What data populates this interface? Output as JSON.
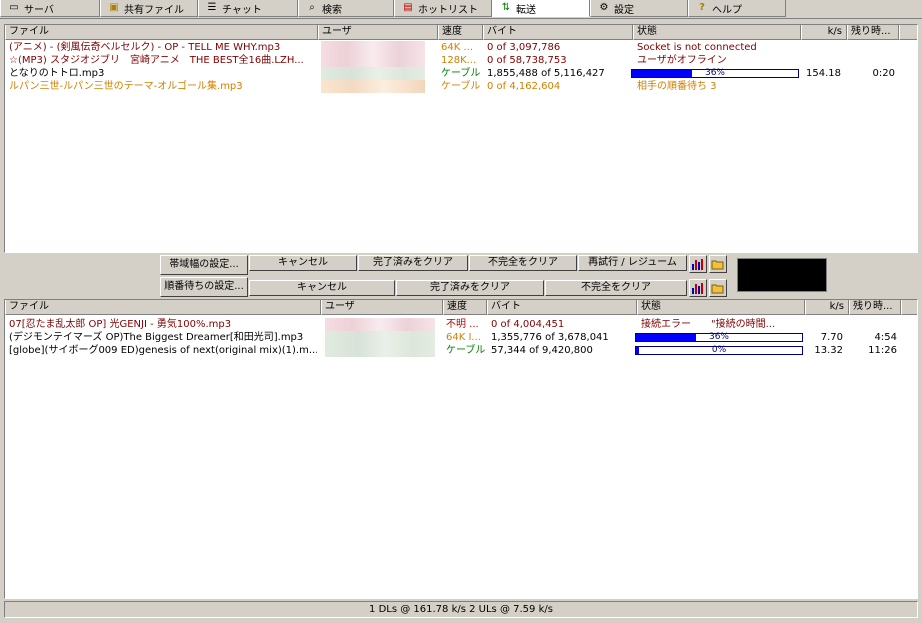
{
  "tabs": [
    {
      "label": "サーバ",
      "icon": "server-icon",
      "glyph": "▭"
    },
    {
      "label": "共有ファイル",
      "icon": "folder-icon",
      "glyph": "▣"
    },
    {
      "label": "チャット",
      "icon": "chat-icon",
      "glyph": "☰"
    },
    {
      "label": "検索",
      "icon": "search-icon",
      "glyph": "⌕"
    },
    {
      "label": "ホットリスト",
      "icon": "hotlist-icon",
      "glyph": "▤"
    },
    {
      "label": "転送",
      "icon": "transfer-arrows-icon",
      "glyph": "⇅"
    },
    {
      "label": "設定",
      "icon": "settings-icon",
      "glyph": "⚙"
    },
    {
      "label": "ヘルプ",
      "icon": "help-icon",
      "glyph": "?"
    }
  ],
  "downloads": {
    "columns": {
      "file": "ファイル",
      "user": "ユーザ",
      "speed": "速度",
      "bytes": "バイト",
      "status": "状態",
      "rate": "k/s",
      "remaining": "残り時..."
    },
    "rows": [
      {
        "file": "(アニメ) - (剣風伝奇ベルセルク) - OP - TELL ME WHY.mp3",
        "speed": "64K ...",
        "bytes": "0 of 3,097,786",
        "status": "Socket is not connected",
        "rate": "",
        "remaining": "",
        "color": "#800000",
        "speed_color": "#d08000"
      },
      {
        "file": "☆(MP3) スタジオジブリ　宮崎アニメ　THE BEST全16曲.LZH...",
        "speed": "128K...",
        "bytes": "0 of 58,738,753",
        "status": "ユーザがオフライン",
        "rate": "",
        "remaining": "",
        "color": "#800000",
        "speed_color": "#d08000"
      },
      {
        "file": "となりのトトロ.mp3",
        "speed": "ケーブル",
        "bytes": "1,855,488 of 5,116,427",
        "status": "",
        "progress": 36,
        "progress_label": "36%",
        "rate": "154.18",
        "remaining": "0:20",
        "color": "#000000",
        "speed_color": "#008000"
      },
      {
        "file": "ルパン三世-ルパン三世のテーマ-オルゴール集.mp3",
        "speed": "ケーブル",
        "bytes": "0 of 4,162,604",
        "status": "相手の順番待ち  3",
        "rate": "",
        "remaining": "",
        "color": "#d08000",
        "speed_color": "#d08000"
      }
    ]
  },
  "controls": {
    "bandwidth_label": "帯域幅の設定...",
    "queue_label": "順番待ちの設定...",
    "dl_cancel": "キャンセル",
    "dl_clear_done": "完了済みをクリア",
    "dl_clear_incomplete": "不完全をクリア",
    "dl_retry": "再試行 / レジューム",
    "ul_cancel": "キャンセル",
    "ul_clear_done": "完了済みをクリア",
    "ul_clear_incomplete": "不完全をクリア"
  },
  "uploads": {
    "columns": {
      "file": "ファイル",
      "user": "ユーザ",
      "speed": "速度",
      "bytes": "バイト",
      "status": "状態",
      "rate": "k/s",
      "remaining": "残り時..."
    },
    "rows": [
      {
        "file": "07[忍たま乱太郎 OP] 光GENJI - 勇気100%.mp3",
        "speed": "不明 ...",
        "bytes": "0 of 4,004,451",
        "status": "接続エラー　　\"接続の時間...",
        "rate": "",
        "remaining": "",
        "color": "#800000",
        "speed_color": "#c00000"
      },
      {
        "file": "(デジモンテイマーズ OP)The Biggest Dreamer[和田光司].mp3",
        "speed": "64K I...",
        "bytes": "1,355,776 of 3,678,041",
        "status": "",
        "progress": 36,
        "progress_label": "36%",
        "rate": "7.70",
        "remaining": "4:54",
        "color": "#000000",
        "speed_color": "#d08000"
      },
      {
        "file": "[globe](サイボーグ009 ED)genesis of next(original mix)(1).m...",
        "speed": "ケーブル",
        "bytes": "57,344 of 9,420,800",
        "status": "",
        "progress": 0,
        "progress_label": "0%",
        "rate": "13.32",
        "remaining": "11:26",
        "color": "#000000",
        "speed_color": "#008000"
      }
    ]
  },
  "status": "1 DLs @ 161.78 k/s  2 ULs @ 7.59 k/s"
}
